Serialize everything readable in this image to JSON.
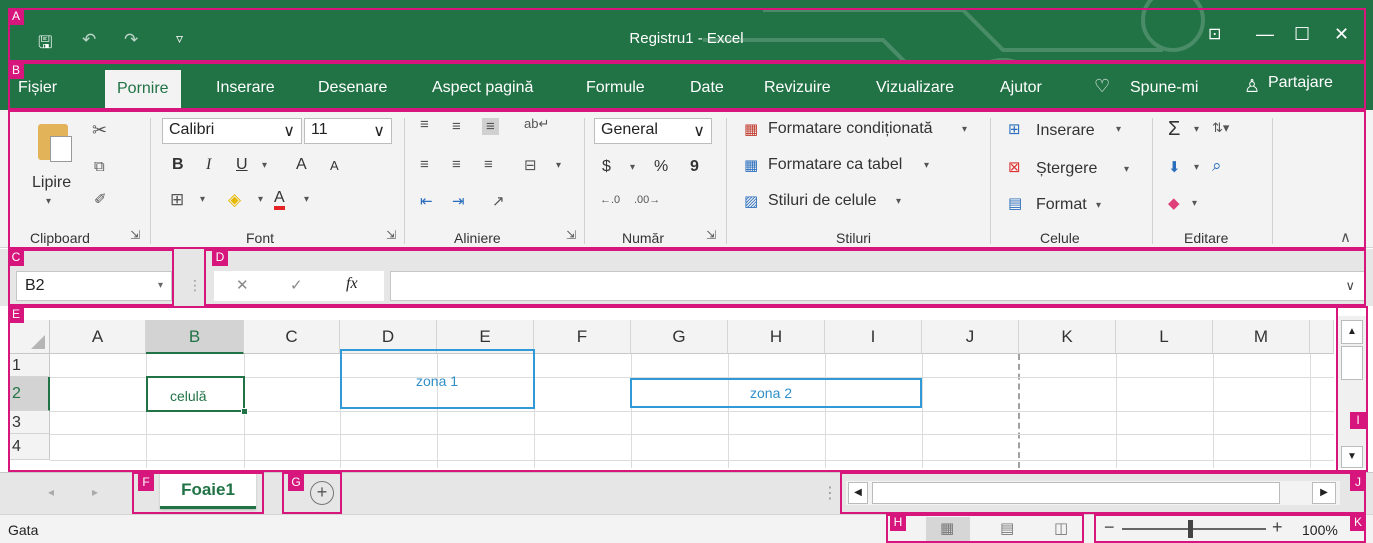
{
  "window": {
    "title": "Registru1  -  Excel",
    "quick_access": {
      "save": "🖫",
      "undo": "↶",
      "redo": "↷",
      "customize": "▿"
    },
    "controls": {
      "ribbon_display": "⊡",
      "minimize": "—",
      "maximize": "☐",
      "close": "✕"
    }
  },
  "tabs": [
    {
      "label": "Fișier"
    },
    {
      "label": "Pornire"
    },
    {
      "label": "Inserare"
    },
    {
      "label": "Desenare"
    },
    {
      "label": "Aspect pagină"
    },
    {
      "label": "Formule"
    },
    {
      "label": "Date"
    },
    {
      "label": "Revizuire"
    },
    {
      "label": "Vizualizare"
    },
    {
      "label": "Ajutor"
    }
  ],
  "tell_me": "Spune-mi",
  "share": "Partajare",
  "ribbon": {
    "clipboard": {
      "label": "Clipboard",
      "paste": "Lipire"
    },
    "font": {
      "label": "Font",
      "name": "Calibri",
      "size": "11",
      "bold": "B",
      "italic": "I",
      "underline": "U",
      "grow": "A",
      "shrink": "A",
      "color_a": "A"
    },
    "alignment": {
      "label": "Aliniere"
    },
    "number": {
      "label": "Număr",
      "format": "General",
      "currency": "$",
      "percent": "%",
      "comma": "9"
    },
    "styles": {
      "label": "Stiluri",
      "conditional": "Formatare condiționată",
      "as_table": "Formatare ca tabel",
      "cell_styles": "Stiluri de celule"
    },
    "cells": {
      "label": "Celule",
      "insert": "Inserare",
      "delete": "Ștergere",
      "format": "Format"
    },
    "editing": {
      "label": "Editare",
      "sum": "Σ"
    }
  },
  "formula_bar": {
    "name_box": "B2",
    "cancel": "✕",
    "enter": "✓",
    "fx": "fx",
    "value": ""
  },
  "grid": {
    "columns": [
      "A",
      "B",
      "C",
      "D",
      "E",
      "F",
      "G",
      "H",
      "I",
      "J",
      "K",
      "L",
      "M"
    ],
    "rows": [
      "1",
      "2",
      "3",
      "4"
    ],
    "cell_b2": "celulă",
    "zone1": "zona 1",
    "zone2": "zona 2"
  },
  "sheets": {
    "active": "Foaie1",
    "add": "+"
  },
  "status": {
    "text": "Gata",
    "zoom": "100%"
  },
  "annotations": [
    "A",
    "B",
    "C",
    "D",
    "E",
    "F",
    "G",
    "H",
    "I",
    "J",
    "K"
  ],
  "colors": {
    "brand_green": "#217346",
    "annotation": "#d6167c",
    "zone_border": "#2f9ad6"
  }
}
